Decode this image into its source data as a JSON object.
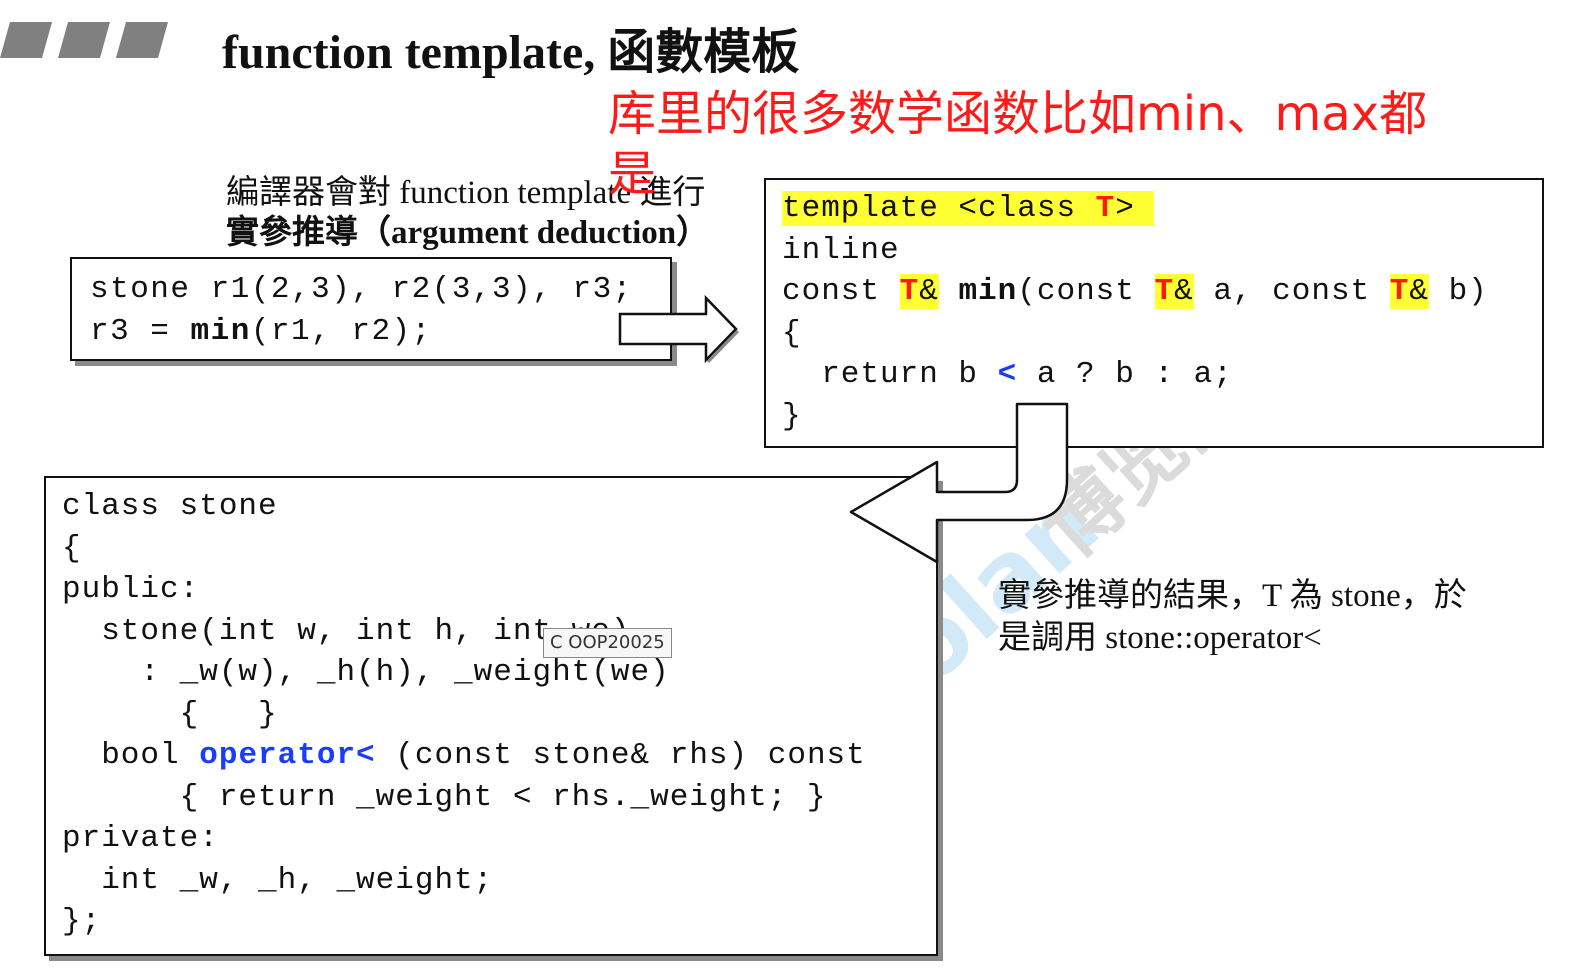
{
  "title": "function template, 函數模板",
  "annotation": {
    "line1": "库里的很多数学函数比如min、max都",
    "line2": "是"
  },
  "caption": {
    "line1": "編譯器會對 function template 進行",
    "line2": "實參推導（argument deduction）"
  },
  "call_code": {
    "line1": "stone r1(2,3), r2(3,3), r3;",
    "line2_prefix": "r3 = ",
    "line2_fn": "min",
    "line2_suffix": "(r1, r2);"
  },
  "template_code": {
    "l1_pre": "template <class ",
    "l1_T": "T",
    "l1_post": ">",
    "l2": "inline",
    "l3_a": "const ",
    "T": "T",
    "amp": "&",
    "l3_fn": "min",
    "l3_b": "(const ",
    "l3_c": " a, const ",
    "l3_d": " b)",
    "l4": "{",
    "l5_a": "  return b ",
    "l5_op": "<",
    "l5_b": " a ? b : a;",
    "l6": "}"
  },
  "class_code": {
    "l1": "class stone",
    "l2": "{",
    "l3": "public:",
    "l4": "  stone(int w, int h, int we)",
    "l5": "    : _w(w), _h(h), _weight(we)",
    "l6": "      {   }",
    "l7_a": "  bool ",
    "l7_op": "operator<",
    "l7_b": " (const stone& rhs) const",
    "l8": "      { return _weight < rhs._weight; }",
    "l9": "private:",
    "l10": "  int _w, _h, _weight;",
    "l11": "};"
  },
  "description": {
    "line1": "實參推導的結果，T 為 stone，於",
    "line2": "是調用 stone::operator<"
  },
  "tooltip": "C  OOP20025",
  "watermark": {
    "brand": "Boolan",
    "cn": "博览网"
  },
  "colors": {
    "highlight": "#ffff33",
    "red": "#ff1a1a",
    "blue": "#1a3cff",
    "watermark": "#9ccfee"
  }
}
